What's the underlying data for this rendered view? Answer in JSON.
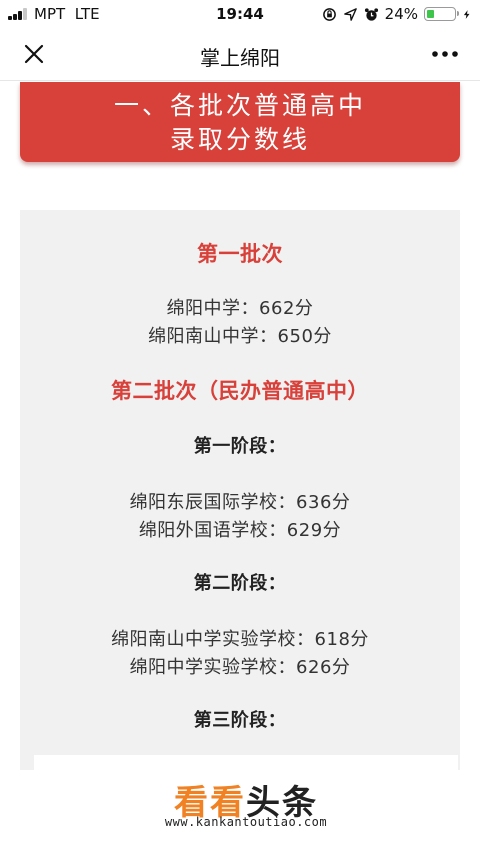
{
  "status_bar": {
    "carrier": "MPT",
    "network": "LTE",
    "time": "19:44",
    "battery": "24%",
    "battery_level": 0.24
  },
  "nav": {
    "title": "掌上绵阳"
  },
  "banner": {
    "line1": "一、各批次普通高中",
    "line2": "录取分数线"
  },
  "content": {
    "batch1_title": "第一批次",
    "batch1_items": [
      "绵阳中学：662分",
      "绵阳南山中学：650分"
    ],
    "batch2_title": "第二批次（民办普通高中）",
    "stage1_title": "第一阶段：",
    "stage1_items": [
      "绵阳东辰国际学校：636分",
      "绵阳外国语学校：629分"
    ],
    "stage2_title": "第二阶段：",
    "stage2_items": [
      "绵阳南山中学实验学校：618分",
      "绵阳中学实验学校：626分"
    ],
    "stage3_title": "第三阶段："
  },
  "watermark": {
    "logo_part1": "看看",
    "logo_part2": "头条",
    "url": "www.kankantoutiao.com"
  },
  "colors": {
    "accent_red": "#d8403a",
    "panel_gray": "#f1f1f1",
    "logo_orange": "#f08224"
  }
}
